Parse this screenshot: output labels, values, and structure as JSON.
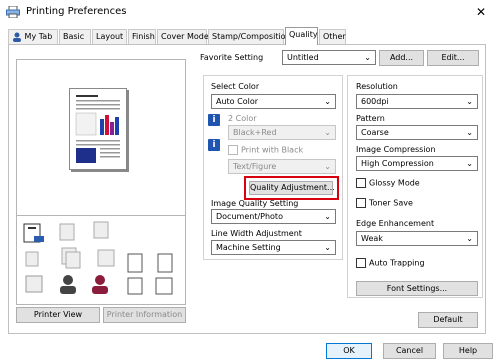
{
  "window": {
    "title": "Printing Preferences",
    "close": "✕"
  },
  "tabs": [
    {
      "label": "My Tab"
    },
    {
      "label": "Basic"
    },
    {
      "label": "Layout"
    },
    {
      "label": "Finish"
    },
    {
      "label": "Cover Mode"
    },
    {
      "label": "Stamp/Composition"
    },
    {
      "label": "Quality"
    },
    {
      "label": "Other"
    }
  ],
  "favorite": {
    "label": "Favorite Setting",
    "value": "Untitled",
    "add": "Add...",
    "edit": "Edit..."
  },
  "left_buttons": {
    "printer_view": "Printer View",
    "printer_information": "Printer Information"
  },
  "select_color": {
    "label": "Select Color",
    "value": "Auto Color"
  },
  "two_color": {
    "label": "2 Color",
    "value": "Black+Red"
  },
  "print_with_black": {
    "label": "Print with Black",
    "value": "Text/Figure"
  },
  "quality_adjustment": {
    "label": "Quality Adjustment..."
  },
  "image_quality": {
    "label": "Image Quality Setting",
    "value": "Document/Photo"
  },
  "line_width": {
    "label": "Line Width Adjustment",
    "value": "Machine Setting"
  },
  "resolution": {
    "label": "Resolution",
    "value": "600dpi"
  },
  "pattern": {
    "label": "Pattern",
    "value": "Coarse"
  },
  "image_compression": {
    "label": "Image Compression",
    "value": "High Compression"
  },
  "glossy": {
    "label": "Glossy Mode"
  },
  "toner_save": {
    "label": "Toner Save"
  },
  "edge": {
    "label": "Edge Enhancement",
    "value": "Weak"
  },
  "auto_trapping": {
    "label": "Auto Trapping"
  },
  "font_settings": {
    "label": "Font Settings..."
  },
  "default": {
    "label": "Default"
  },
  "dialog": {
    "ok": "OK",
    "cancel": "Cancel",
    "help": "Help"
  },
  "colors": {
    "highlight": "#d8000f",
    "info_icon": "#1f54b0",
    "focus_border": "#0078d7"
  }
}
